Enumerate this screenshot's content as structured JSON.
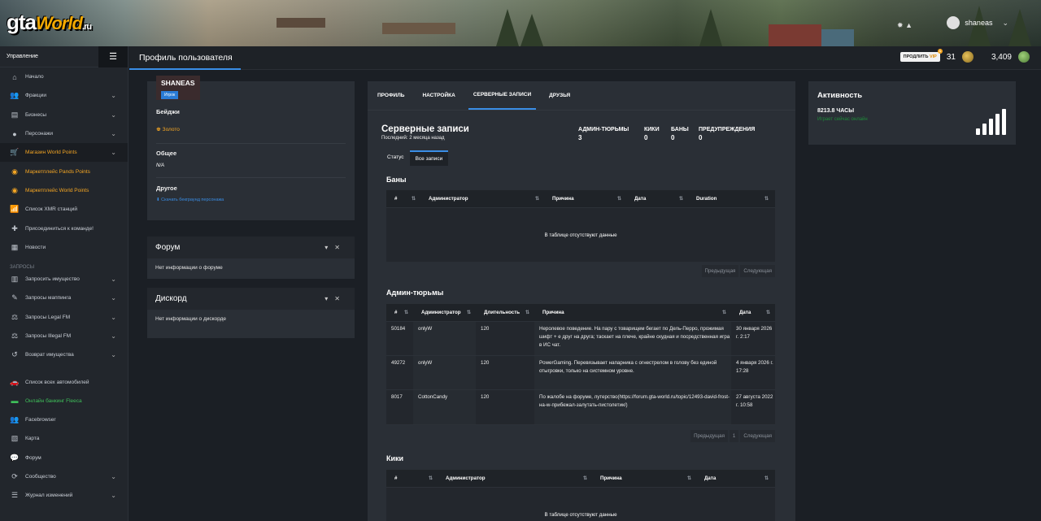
{
  "brand": {
    "logo_gta": "gta",
    "logo_world": "World",
    "logo_ru": ".ru"
  },
  "header": {
    "username": "shaneas",
    "icons": [
      "settings-icon",
      "bell-icon"
    ]
  },
  "sidebar": {
    "title": "Управление",
    "items": [
      {
        "label": "Начало",
        "icon": "home-icon",
        "arrow": false
      },
      {
        "label": "Фракции",
        "icon": "users-icon",
        "arrow": true
      },
      {
        "label": "Бизнесы",
        "icon": "briefcase-icon",
        "arrow": true
      },
      {
        "label": "Персонажи",
        "icon": "user-icon",
        "arrow": true
      },
      {
        "label": "Магазин World Points",
        "icon": "cart-icon",
        "arrow": true
      },
      {
        "label": "Маркетплейс Pands Points",
        "icon": "coins-icon",
        "arrow": false
      },
      {
        "label": "Маркетплейс World Points",
        "icon": "coins-icon",
        "arrow": false
      },
      {
        "label": "Список XMR станций",
        "icon": "radio-icon",
        "arrow": false
      },
      {
        "label": "Присоединиться к команде!",
        "icon": "user-plus-icon",
        "arrow": false
      },
      {
        "label": "Новости",
        "icon": "news-icon",
        "arrow": false
      }
    ],
    "section_requests": "ЗАПРОСЫ",
    "request_items": [
      {
        "label": "Запросить имущество",
        "icon": "building-icon",
        "arrow": true
      },
      {
        "label": "Запросы маппинга",
        "icon": "brush-icon",
        "arrow": true
      },
      {
        "label": "Запросы Legal FM",
        "icon": "scale-icon",
        "arrow": true
      },
      {
        "label": "Запросы Illegal FM",
        "icon": "scale-icon",
        "arrow": true
      },
      {
        "label": "Возврат имущества",
        "icon": "undo-icon",
        "arrow": true
      }
    ],
    "bottom_items": [
      {
        "label": "Список всех автомобилей",
        "icon": "car-icon",
        "arrow": false
      },
      {
        "label": "Онлайн банкинг Fleeca",
        "icon": "bank-icon",
        "arrow": false
      },
      {
        "label": "Facebrowser",
        "icon": "users-icon",
        "arrow": false
      },
      {
        "label": "Карта",
        "icon": "map-icon",
        "arrow": false
      },
      {
        "label": "Форум",
        "icon": "forum-icon",
        "arrow": false
      },
      {
        "label": "Сообщество",
        "icon": "share-icon",
        "arrow": true
      },
      {
        "label": "Журнал изменений",
        "icon": "list-icon",
        "arrow": true
      }
    ]
  },
  "topbar": {
    "page_title": "Профиль пользователя",
    "vip_prefix": "ПРОДЛИТЬ",
    "vip_suffix": "VIP",
    "vip_badge": "1",
    "coins_a": "31",
    "coins_b": "3,409"
  },
  "profile": {
    "name": "SHANEAS",
    "role": "Игрок",
    "badges_label": "Бейджи",
    "badge_value": "Золото",
    "general_label": "Общее",
    "general_value": "N/A",
    "other_label": "Другое",
    "download_link": "Скачать бекграунд персонажа"
  },
  "forum_panel": {
    "title": "Форум",
    "text": "Нет информации о форуме"
  },
  "discord_panel": {
    "title": "Дискорд",
    "text": "Нет информации о дискорде"
  },
  "tabs": [
    "ПРОФИЛЬ",
    "НАСТРОЙКА",
    "СЕРВЕРНЫЕ ЗАПИСИ",
    "ДРУЗЬЯ"
  ],
  "records": {
    "title": "Серверные записи",
    "subtitle": "Последний: 2 месяца назад",
    "stats": [
      {
        "key": "АДМИН-ТЮРЬМЫ",
        "value": "3"
      },
      {
        "key": "КИКИ",
        "value": "0"
      },
      {
        "key": "БАНЫ",
        "value": "0"
      },
      {
        "key": "ПРЕДУПРЕЖДЕНИЯ",
        "value": "0"
      }
    ],
    "subtabs": [
      "Статус",
      "Все записи"
    ],
    "bans": {
      "title": "Баны",
      "headers": [
        "#",
        "Администратор",
        "Причина",
        "Дата",
        "Duration"
      ],
      "empty": "В таблице отсутствуют данные",
      "prev": "Предыдущая",
      "next": "Следующая"
    },
    "jails": {
      "title": "Админ-тюрьмы",
      "headers": [
        "#",
        "Администратор",
        "Длительность",
        "Причина",
        "Дата"
      ],
      "rows": [
        {
          "id": "50184",
          "admin": "onlyW",
          "duration": "120",
          "reason": "Неролевое поведение. На пару с товарищем бегает по Дель-Перро, прожимая шифт + е друг на друга; таскает на плече, крайне скудная и посредственная игра в ИС чат.",
          "date": "30 января 2026 г. 2:17"
        },
        {
          "id": "49272",
          "admin": "onlyW",
          "duration": "120",
          "reason": "PowerGaming. Перевязывает напарника с огнестрелом в голову без единой отыгровки, только на системном уровне.",
          "date": "4 января 2026 г. 17:28"
        },
        {
          "id": "8017",
          "admin": "CottonCandy",
          "duration": "120",
          "reason": "По жалобе на форуме, лутерство(https://forum.gta-world.ru/topic/12493-david-frost-на-w-прибежал-залутать-пистолетик/)",
          "date": "27 августа 2022 г. 10:58"
        }
      ],
      "prev": "Предыдущая",
      "page": "1",
      "next": "Следующая"
    },
    "kicks": {
      "title": "Кики",
      "headers": [
        "#",
        "Администратор",
        "Причина",
        "Дата"
      ],
      "empty": "В таблице отсутствуют данные"
    }
  },
  "activity": {
    "title": "Активность",
    "hours": "8213.8 ЧАСЫ",
    "status": "Играет сейчас онлайн",
    "signal_level": 5
  }
}
